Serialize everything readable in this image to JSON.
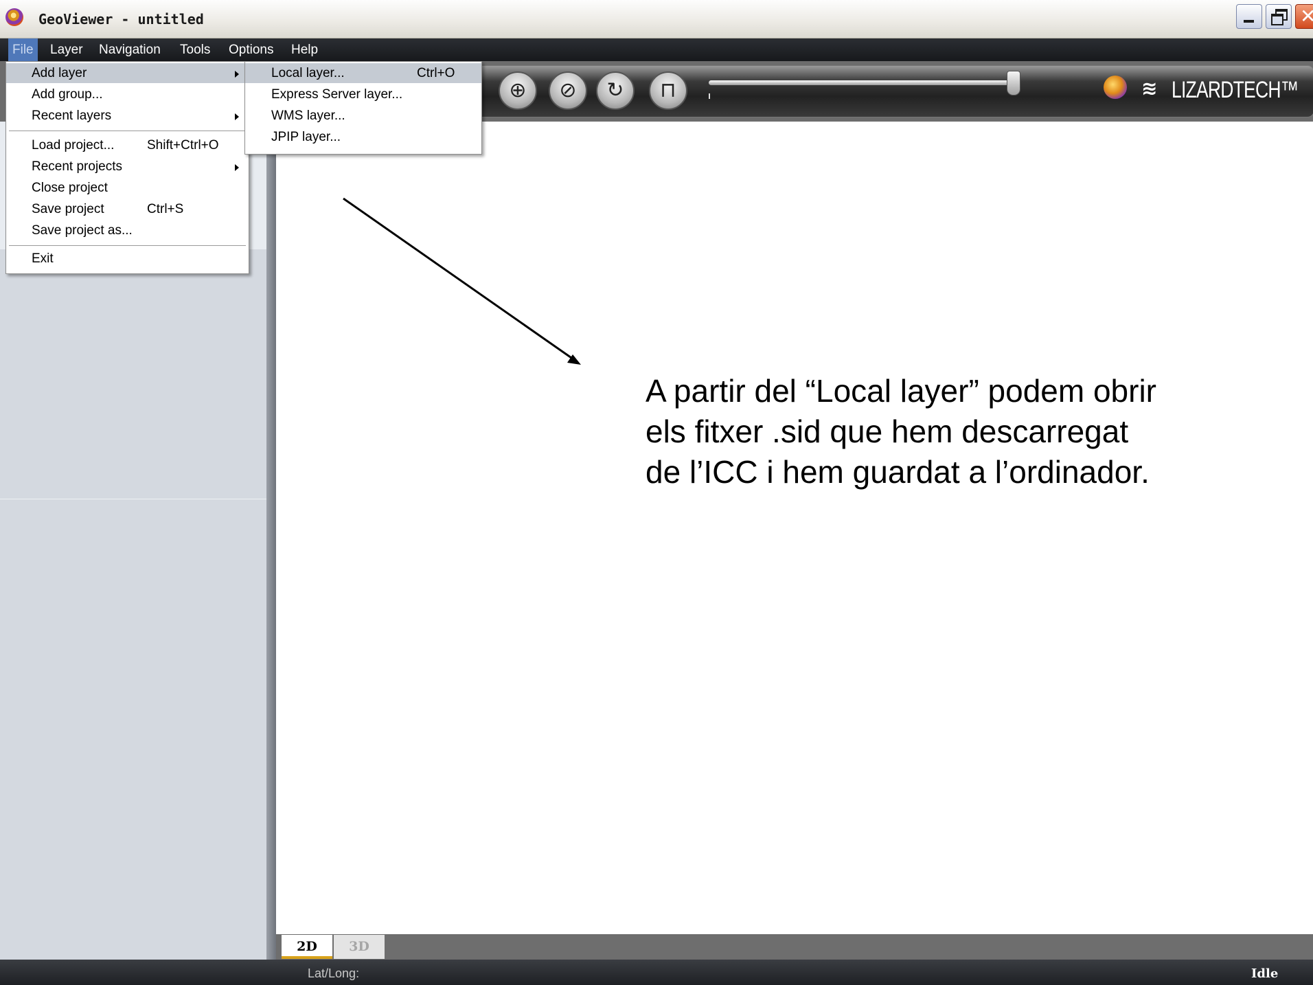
{
  "window": {
    "title": "GeoViewer - untitled",
    "app_icon": "geoviewer-globe-icon",
    "controls": [
      "minimize-icon",
      "restore-icon",
      "close-icon"
    ],
    "close_glyph": "✕"
  },
  "menubar": {
    "items": [
      "File",
      "Layer",
      "Navigation",
      "Tools",
      "Options",
      "Help"
    ],
    "active": "File"
  },
  "toolbar": {
    "buttons": [
      {
        "icon": "pan-target-icon",
        "glyph": "⊕"
      },
      {
        "icon": "rotate-square-icon",
        "glyph": "⊘"
      },
      {
        "icon": "refresh-circle-icon",
        "glyph": "↻"
      },
      {
        "icon": "measure-ruler-icon",
        "glyph": "⊓"
      }
    ],
    "zoom_level": 0.95,
    "brand_icon": "lizardtech-globe-icon",
    "brand_mark": "≋",
    "brand_text": "LIZARDTECH™"
  },
  "file_menu": {
    "items": [
      {
        "label": "Add layer",
        "shortcut": "",
        "submenu": true,
        "highlighted": true
      },
      {
        "label": "Add group...",
        "shortcut": "",
        "submenu": false
      },
      {
        "label": "Recent layers",
        "shortcut": "",
        "submenu": true
      },
      {
        "label": "Load project...",
        "shortcut": "Shift+Ctrl+O",
        "submenu": false
      },
      {
        "label": "Recent projects",
        "shortcut": "",
        "submenu": true
      },
      {
        "label": "Close project",
        "shortcut": "",
        "submenu": false
      },
      {
        "label": "Save project",
        "shortcut": "Ctrl+S",
        "submenu": false
      },
      {
        "label": "Save project as...",
        "shortcut": "",
        "submenu": false
      },
      {
        "label": "Exit",
        "shortcut": "",
        "submenu": false
      }
    ]
  },
  "add_layer_submenu": {
    "items": [
      {
        "label": "Local layer...",
        "shortcut": "Ctrl+O",
        "highlighted": true
      },
      {
        "label": "Express Server layer...",
        "shortcut": ""
      },
      {
        "label": "WMS layer...",
        "shortcut": ""
      },
      {
        "label": "JPIP layer...",
        "shortcut": ""
      }
    ]
  },
  "annotation": {
    "lines": [
      "A partir del “Local layer” podem obrir",
      "els fitxer .sid que hem descarregat",
      "de l’ICC i hem guardat a l’ordinador."
    ]
  },
  "view_tabs": {
    "tab_2d": "2D",
    "tab_3d": "3D",
    "active": "2D"
  },
  "statusbar": {
    "latlong_label": "Lat/Long:",
    "state": "Idle"
  },
  "colors": {
    "menu_highlight": "#c5cbd3",
    "menubar_active": "#4f78b9",
    "tab_accent": "#d8a21a"
  }
}
